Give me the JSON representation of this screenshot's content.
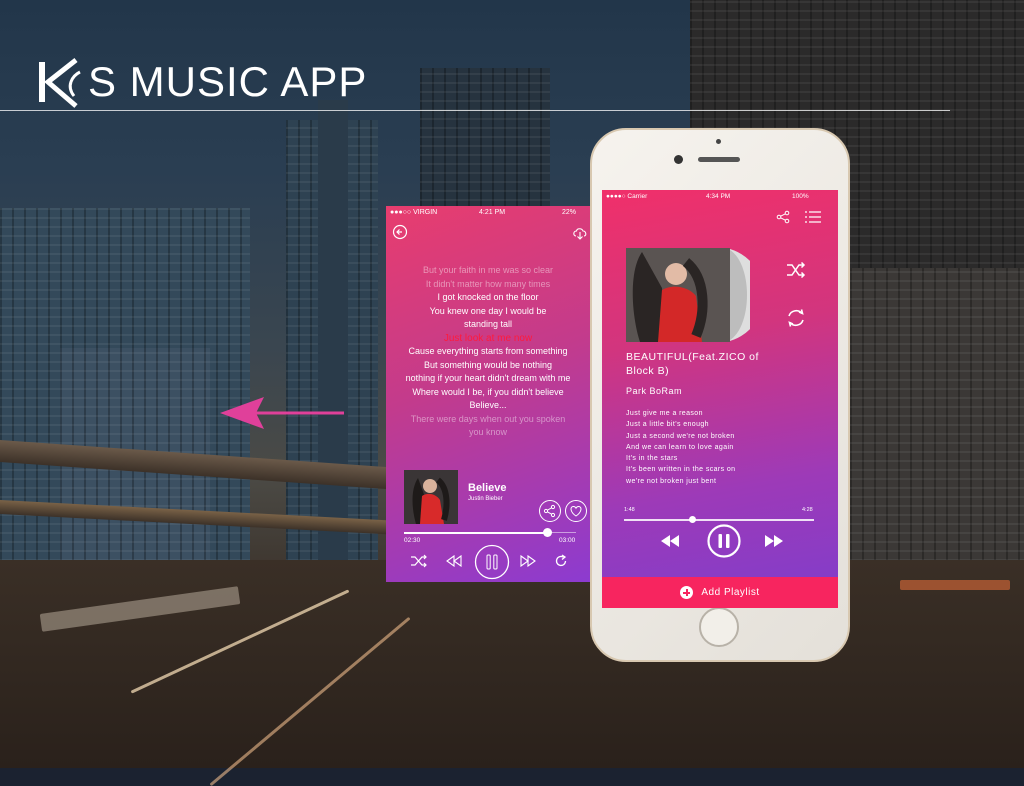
{
  "header": {
    "logo_letter": "K",
    "title": "S MUSIC APP"
  },
  "lyrics_screen": {
    "status": {
      "carrier": "●●●○○ VIRGIN",
      "time": "4:21 PM",
      "battery": "22%"
    },
    "lyrics": [
      {
        "text": "But your faith in me was so clear",
        "style": "dim"
      },
      {
        "text": "It didn't matter how many times",
        "style": "dim"
      },
      {
        "text": "I got knocked on the floor",
        "style": "normal"
      },
      {
        "text": "You knew one day I would be",
        "style": "normal"
      },
      {
        "text": "standing tall",
        "style": "normal"
      },
      {
        "text": "Just look at me now",
        "style": "highlight"
      },
      {
        "text": "Cause everything starts from something",
        "style": "normal"
      },
      {
        "text": "But something would be nothing",
        "style": "normal"
      },
      {
        "text": "nothing if your heart didn't dream with me",
        "style": "normal"
      },
      {
        "text": "Where would I be, if you didn't believe",
        "style": "normal"
      },
      {
        "text": "Believe...",
        "style": "normal"
      },
      {
        "text": "There were days when out you spoken",
        "style": "dim"
      },
      {
        "text": "you know",
        "style": "dim"
      }
    ],
    "now_playing": {
      "song": "Believe",
      "artist": "Justin Bieber"
    },
    "progress": {
      "elapsed": "02:30",
      "total": "03:00",
      "fraction": 0.833
    },
    "icons": [
      "back-icon",
      "download-cloud-icon",
      "share-icon",
      "heart-icon",
      "shuffle-icon",
      "rewind-icon",
      "pause-icon",
      "forward-icon",
      "repeat-icon"
    ]
  },
  "player_screen": {
    "status": {
      "carrier": "●●●●○ Carrier",
      "time": "4:34 PM",
      "battery": "100%"
    },
    "song_title": "BEAUTIFUL(Feat.ZICO of Block B)",
    "artist": "Park BoRam",
    "lyrics": [
      "Just give me a reason",
      "Just a little bit's enough",
      "Just a second we're not broken",
      "And we can learn to love again",
      "It's in the stars",
      "It's been written in the scars on",
      "we're not broken just bent"
    ],
    "progress": {
      "elapsed": "1:48",
      "total": "4:28",
      "fraction": 0.36
    },
    "add_playlist_label": "Add Playlist",
    "icons": [
      "share-icon",
      "playlist-icon",
      "shuffle-icon",
      "repeat-icon",
      "rewind-icon",
      "pause-icon",
      "forward-icon",
      "plus-circle-icon"
    ]
  },
  "colors": {
    "accent_pink": "#f7255f",
    "gradient_purple": "#7f3dcc",
    "lyric_highlight": "#ff1a3c"
  }
}
